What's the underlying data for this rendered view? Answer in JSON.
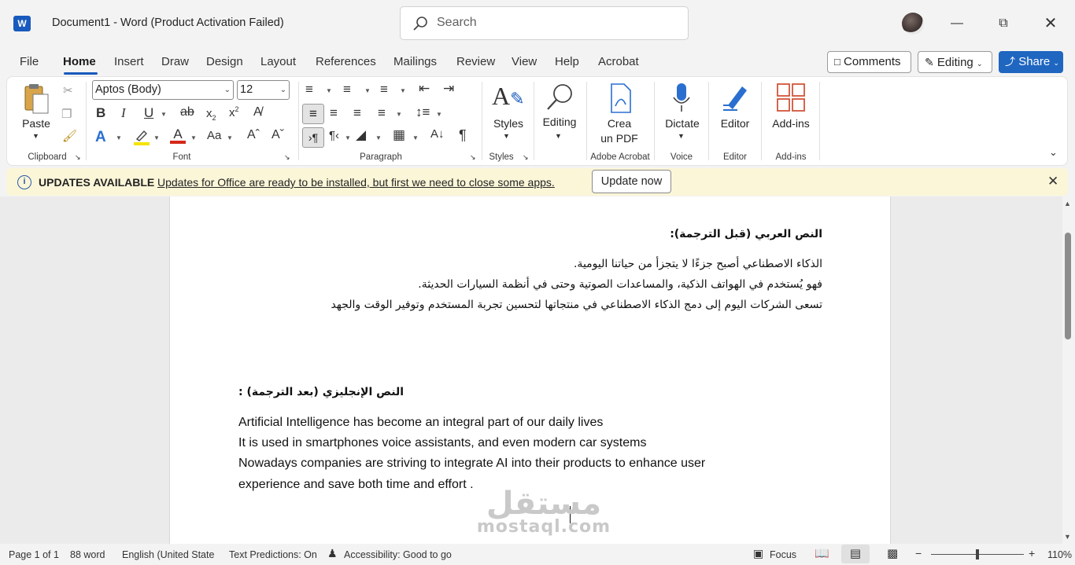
{
  "title_bar": {
    "app_icon": "W",
    "document_title": "Document1  -  Word (Product Activation Failed)",
    "search_placeholder": "Search",
    "window_controls": [
      "minimize-icon",
      "restore-icon",
      "close-icon"
    ]
  },
  "menu": {
    "tabs": [
      "File",
      "Home",
      "Insert",
      "Draw",
      "Design",
      "Layout",
      "References",
      "Mailings",
      "Review",
      "View",
      "Help",
      "Acrobat"
    ],
    "active_tab": "Home",
    "comments_label": "Comments",
    "editing_label": "Editing",
    "share_label": "Share"
  },
  "ribbon": {
    "clipboard": {
      "label": "Clipboard",
      "paste": "Paste"
    },
    "font": {
      "label": "Font",
      "font_name": "Aptos (Body)",
      "font_size": "12"
    },
    "paragraph": {
      "label": "Paragraph"
    },
    "styles": {
      "label": "Styles",
      "button": "Styles"
    },
    "editing": {
      "button": "Editing"
    },
    "adobe": {
      "label": "Adobe Acrobat",
      "button_line1": "Crea",
      "button_line2": "un PDF"
    },
    "voice": {
      "label": "Voice",
      "button": "Dictate"
    },
    "editor": {
      "label": "Editor",
      "button": "Editor"
    },
    "addins": {
      "label": "Add-ins",
      "button": "Add-ins"
    },
    "colors": {
      "highlight": "#f5e400",
      "font_color": "#d4281c",
      "accent": "#185abd"
    }
  },
  "update_bar": {
    "title": "UPDATES AVAILABLE",
    "message": "Updates for Office are ready to be installed, but first we need to close some apps.",
    "button": "Update now"
  },
  "document": {
    "arabic_heading": "النص العربي (قبل الترجمة):",
    "arabic_lines": [
      "الذكاء الاصطناعي أصبح جزءًا لا يتجزأ من حياتنا اليومية.",
      "فهو يُستخدم في الهواتف الذكية، والمساعدات الصوتية  وحتى في أنظمة السيارات الحديثة.",
      "تسعى الشركات اليوم إلى دمج الذكاء الاصطناعي في منتجاتها لتحسين تجربة المستخدم وتوفير الوقت والجهد"
    ],
    "english_heading": "النص الإنجليزي (بعد الترجمة) :",
    "english_lines": [
      "Artificial Intelligence has become an integral part of our daily lives",
      "It is used in smartphones voice assistants, and even modern car systems",
      "Nowadays companies are striving to integrate AI into their products to enhance user",
      "experience and save both time and effort  ."
    ],
    "watermark_ar": "مستقل",
    "watermark_en": "mostaql.com"
  },
  "status_bar": {
    "page": "Page 1 of 1",
    "words": "88 word",
    "language": "English (United State",
    "predictions": "Text Predictions: On",
    "accessibility": "Accessibility: Good to go",
    "focus": "Focus",
    "zoom": "110%"
  }
}
